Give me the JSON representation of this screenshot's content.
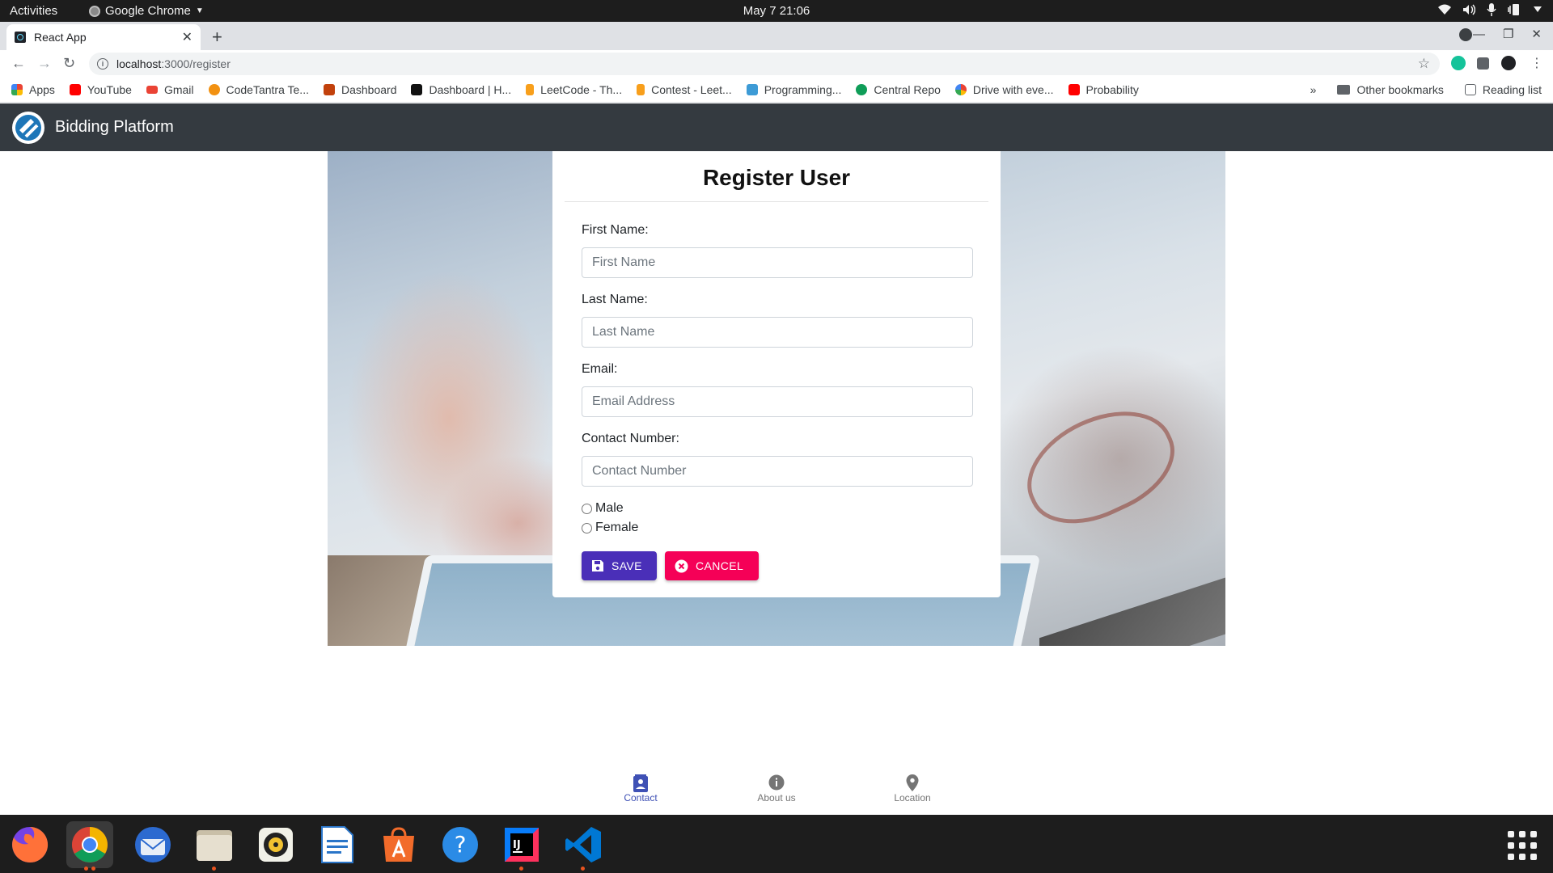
{
  "system_bar": {
    "activities": "Activities",
    "app_menu": "Google Chrome",
    "clock": "May 7  21:06"
  },
  "browser": {
    "tab_title": "React App",
    "url_host": "localhost",
    "url_path": ":3000/register",
    "bookmarks": [
      {
        "label": "Apps",
        "icon": "apps-grid-icon",
        "color": "#4285f4"
      },
      {
        "label": "YouTube",
        "icon": "youtube-icon",
        "color": "#ff0000"
      },
      {
        "label": "Gmail",
        "icon": "gmail-icon",
        "color": "#ea4335"
      },
      {
        "label": "CodeTantra Te...",
        "icon": "codetantra-icon",
        "color": "#f29111"
      },
      {
        "label": "Dashboard",
        "icon": "dashboard-icon",
        "color": "#c2410c"
      },
      {
        "label": "Dashboard | H...",
        "icon": "hackerrank-icon",
        "color": "#111111"
      },
      {
        "label": "LeetCode - Th...",
        "icon": "leetcode-icon",
        "color": "#333333"
      },
      {
        "label": "Contest - Leet...",
        "icon": "leetcode-icon",
        "color": "#333333"
      },
      {
        "label": "Programming...",
        "icon": "interviewbit-icon",
        "color": "#3d9bd6"
      },
      {
        "label": "Central Repo",
        "icon": "central-repo-icon",
        "color": "#0f9d58"
      },
      {
        "label": "Drive with eve...",
        "icon": "google-icon",
        "color": "#4285f4"
      },
      {
        "label": "Probability",
        "icon": "youtube-icon",
        "color": "#ff0000"
      }
    ],
    "more_bookmarks": "»",
    "other_bookmarks": "Other bookmarks",
    "reading_list": "Reading list"
  },
  "app": {
    "brand": "Bidding Platform",
    "form": {
      "title": "Register User",
      "first_name_label": "First Name:",
      "first_name_placeholder": "First Name",
      "last_name_label": "Last Name:",
      "last_name_placeholder": "Last Name",
      "email_label": "Email:",
      "email_placeholder": "Email Address",
      "contact_label": "Contact Number:",
      "contact_placeholder": "Contact Number",
      "gender_options": [
        "Male",
        "Female"
      ],
      "save_label": "SAVE",
      "cancel_label": "CANCEL"
    },
    "bottom_nav": [
      {
        "label": "Contact",
        "icon": "contact-icon",
        "active": true
      },
      {
        "label": "About us",
        "icon": "info-icon",
        "active": false
      },
      {
        "label": "Location",
        "icon": "location-pin-icon",
        "active": false
      }
    ]
  },
  "colors": {
    "appbar": "#343a40",
    "save_button": "#4a2fb8",
    "cancel_button": "#f50057",
    "nav_active": "#3f51b5"
  },
  "dock": [
    {
      "name": "firefox-icon",
      "running": false
    },
    {
      "name": "chrome-icon",
      "running": true
    },
    {
      "name": "thunderbird-icon",
      "running": false
    },
    {
      "name": "files-icon",
      "running": true
    },
    {
      "name": "rhythmbox-icon",
      "running": false
    },
    {
      "name": "libreoffice-writer-icon",
      "running": false
    },
    {
      "name": "software-center-icon",
      "running": false
    },
    {
      "name": "help-icon",
      "running": false
    },
    {
      "name": "intellij-icon",
      "running": true
    },
    {
      "name": "vscode-icon",
      "running": true
    }
  ]
}
